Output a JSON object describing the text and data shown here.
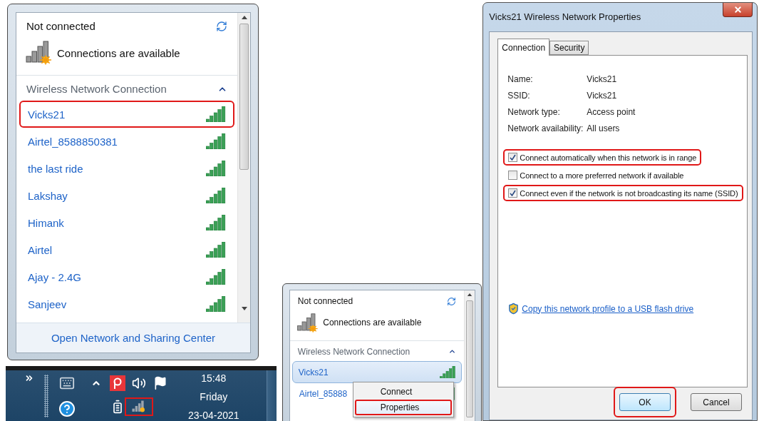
{
  "left_flyout": {
    "status": "Not connected",
    "availability": "Connections are available",
    "section": "Wireless Network Connection",
    "networks": [
      {
        "name": "Vicks21",
        "highlighted": true
      },
      {
        "name": "Airtel_8588850381",
        "highlighted": false
      },
      {
        "name": "the last ride",
        "highlighted": false
      },
      {
        "name": "Lakshay",
        "highlighted": false
      },
      {
        "name": "Himank",
        "highlighted": false
      },
      {
        "name": "Airtel",
        "highlighted": false
      },
      {
        "name": "Ajay - 2.4G",
        "highlighted": false
      },
      {
        "name": "Sanjeev",
        "highlighted": false
      }
    ],
    "footer_link": "Open Network and Sharing Center"
  },
  "taskbar": {
    "time": "15:48",
    "day": "Friday",
    "date": "23-04-2021",
    "network_icon_highlighted": true
  },
  "middle_flyout": {
    "status": "Not connected",
    "availability": "Connections are available",
    "section": "Wireless Network Connection",
    "networks": [
      {
        "name": "Vicks21",
        "selected": true
      },
      {
        "name": "Airtel_85888",
        "selected": false
      }
    ],
    "context_menu": [
      {
        "label": "Connect",
        "highlighted": false
      },
      {
        "label": "Properties",
        "highlighted": true
      }
    ]
  },
  "dialog": {
    "title": "Vicks21 Wireless Network Properties",
    "tabs": [
      {
        "label": "Connection",
        "selected": true
      },
      {
        "label": "Security",
        "selected": false
      }
    ],
    "fields": [
      {
        "label": "Name:",
        "value": "Vicks21"
      },
      {
        "label": "SSID:",
        "value": "Vicks21"
      },
      {
        "label": "Network type:",
        "value": "Access point"
      },
      {
        "label": "Network availability:",
        "value": "All users"
      }
    ],
    "options": [
      {
        "label": "Connect automatically when this network is in range",
        "checked": true,
        "highlighted": true
      },
      {
        "label": "Connect to a more preferred network if available",
        "checked": false,
        "highlighted": false
      },
      {
        "label": "Connect even if the network is not broadcasting its name (SSID)",
        "checked": true,
        "highlighted": true
      }
    ],
    "link": "Copy this network profile to a USB flash drive",
    "buttons": [
      {
        "label": "OK",
        "highlighted": true,
        "kind": "default"
      },
      {
        "label": "Cancel",
        "highlighted": false,
        "kind": "normal"
      }
    ]
  }
}
